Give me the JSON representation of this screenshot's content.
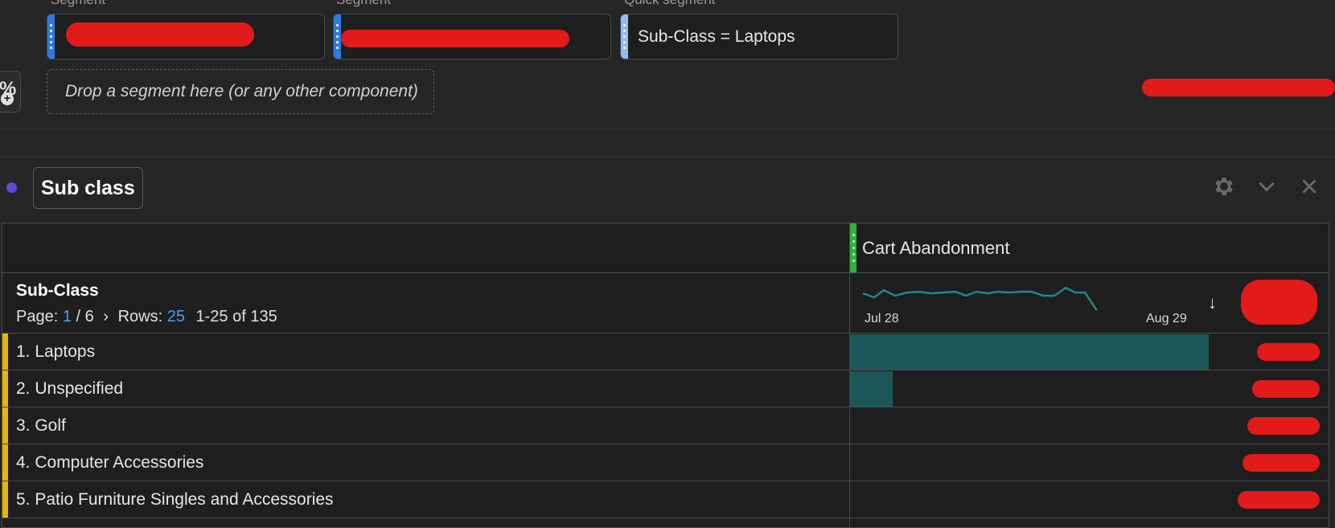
{
  "segments": {
    "items": [
      {
        "label": "Segment",
        "value": ""
      },
      {
        "label": "Segment",
        "value": ""
      },
      {
        "label": "Quick segment",
        "value": "Sub-Class = Laptops"
      }
    ],
    "drop_placeholder": "Drop a segment here (or any other component)",
    "accent_color": "#2d7be0"
  },
  "panel": {
    "title": "Sub class",
    "dot_color": "#5b4ad6"
  },
  "table": {
    "metric_column": "Cart Abandonment",
    "dimension": "Sub-Class",
    "pager": {
      "page_label": "Page:",
      "page_current": "1",
      "page_total": "/ 6",
      "rows_label": "Rows:",
      "rows_value": "25",
      "range": "1-25 of 135"
    },
    "sparkline": {
      "start_label": "Jul 28",
      "end_label": "Aug 29",
      "color": "#1f8a8a"
    },
    "rows": [
      {
        "label": "1.  Laptops",
        "bar_fraction": 0.75
      },
      {
        "label": "2.  Unspecified",
        "bar_fraction": 0.09
      },
      {
        "label": "3.  Golf",
        "bar_fraction": 0
      },
      {
        "label": "4.  Computer Accessories",
        "bar_fraction": 0
      },
      {
        "label": "5.  Patio Furniture Singles and Accessories",
        "bar_fraction": 0
      }
    ]
  },
  "icons": [
    "percent-add-icon",
    "settings-gear-icon",
    "chevron-down-icon",
    "close-icon",
    "sort-down-arrow-icon"
  ]
}
